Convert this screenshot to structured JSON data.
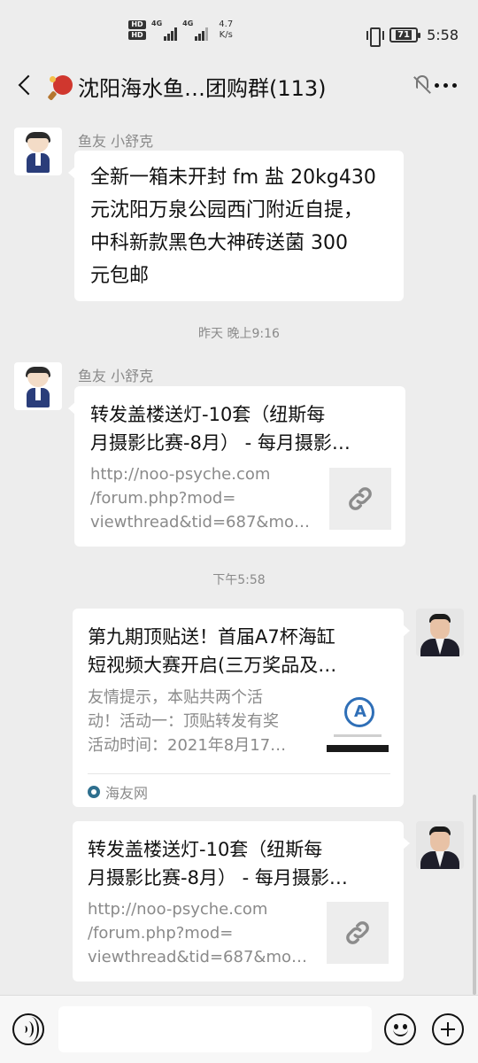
{
  "status_bar": {
    "hd_badges": [
      "HD",
      "HD"
    ],
    "network_labels": [
      "4G",
      "4G"
    ],
    "speed_value": "4.7",
    "speed_unit": "K/s",
    "battery": "71",
    "time": "5:58"
  },
  "header": {
    "title": "沈阳海水鱼…团购群(113)",
    "icons": [
      "back-arrow-icon",
      "ping-pong-paddle-icon",
      "mute-bell-icon",
      "more-icon"
    ]
  },
  "messages": [
    {
      "type": "text",
      "sender": "鱼友 小舒克",
      "avatar": "cartoon-boy-avatar",
      "text_lines": [
        "全新一箱未开封 fm 盐 20kg430",
        "元沈阳万泉公园西门附近自提，",
        "中科新款黑色大神砖送菌 300",
        "元包邮"
      ]
    },
    {
      "type": "time",
      "text": "昨天 晚上9:16"
    },
    {
      "type": "link",
      "sender": "鱼友 小舒克",
      "avatar": "cartoon-boy-avatar",
      "title_lines": [
        "转发盖楼送灯-10套（纽斯每",
        "月摄影比赛-8月） - 每月摄影…"
      ],
      "desc_lines": [
        "http://noo-psyche.com",
        "/forum.php?mod=",
        "viewthread&tid=687&mo…"
      ],
      "thumb_icon": "link-icon"
    },
    {
      "type": "time",
      "text": "下午5:58"
    },
    {
      "type": "article",
      "avatar": "man-in-suit-avatar",
      "title_lines": [
        "第九期顶贴送！首届A7杯海缸",
        "短视频大赛开启(三万奖品及…"
      ],
      "desc_lines": [
        "友情提示，本贴共两个活",
        "动！活动一：顶贴转发有奖",
        "活动时间：2021年8月17…"
      ],
      "source": "海友网"
    },
    {
      "type": "link",
      "avatar": "man-in-suit-avatar",
      "title_lines": [
        "转发盖楼送灯-10套（纽斯每",
        "月摄影比赛-8月） - 每月摄影…"
      ],
      "desc_lines": [
        "http://noo-psyche.com",
        "/forum.php?mod=",
        "viewthread&tid=687&mo…"
      ],
      "thumb_icon": "link-icon"
    }
  ],
  "input_bar": {
    "placeholder": "",
    "icons": [
      "voice-icon",
      "emoji-icon",
      "plus-icon"
    ]
  }
}
